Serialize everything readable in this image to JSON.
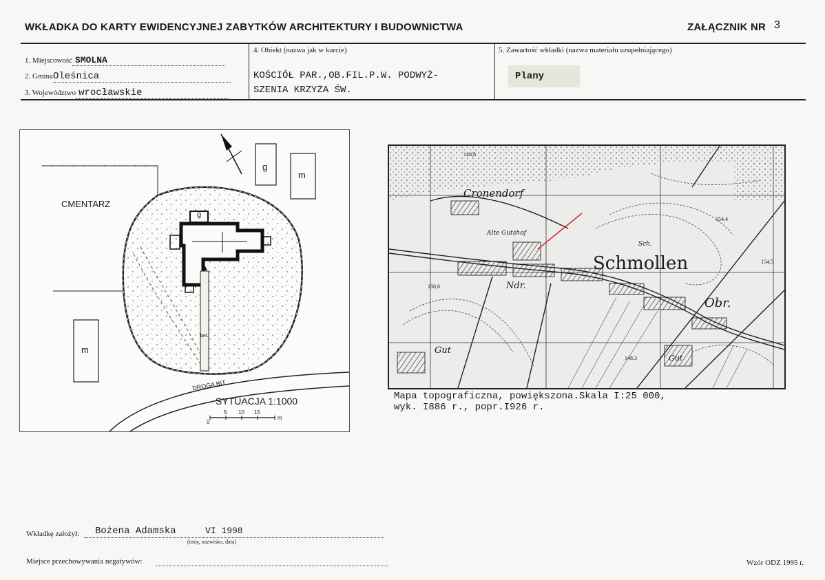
{
  "header": {
    "title": "WKŁADKA DO KARTY EWIDENCYJNEJ ZABYTKÓW ARCHITEKTURY I BUDOWNICTWA",
    "annex": "ZAŁĄCZNIK NR",
    "annex_number": "3"
  },
  "fields": {
    "place_label": "1. Miejscowość",
    "place_value": "SMOLNA",
    "commune_label": "2. Gmina",
    "commune_value": "Oleśnica",
    "voivodeship_label": "3. Województwo",
    "voivodeship_value": "wrocławskie",
    "object_label": "4. Obiekt (nazwa jak w karcie)",
    "object_value_line1": "KOŚCIÓŁ PAR.,OB.FIL.P.W. PODWYŻ-",
    "object_value_line2": "SZENIA KRZYŻA ŚW.",
    "content_label": "5. Zawartość wkładki (nazwa materiału uzupełniającego)",
    "content_value": "Plany"
  },
  "site_plan": {
    "cemetery_label": "CMENTARZ",
    "building_g": "g",
    "building_m": "m",
    "road_label": "DROGA BIT.",
    "path_label": "bet.",
    "scale_title": "SYTUACJA 1:1000",
    "scale_ticks": [
      "0",
      "5",
      "10",
      "15"
    ],
    "scale_unit": "m"
  },
  "map": {
    "town_label": "Schmollen",
    "village_label": "Cronendorf",
    "labels": [
      "Alte Gutshof",
      "Ndr.",
      "Obr.",
      "Gut",
      "Gut",
      "Sch."
    ],
    "elevations": [
      "140,8",
      "138,6",
      "154,4",
      "154,5",
      "148,3"
    ],
    "caption_line1": "Mapa topograficzna, powiększona.Skala I:25 000,",
    "caption_line2": "wyk. I886 r., popr.I926 r."
  },
  "footer": {
    "author_label": "Wkładkę założył:",
    "author_value": "Bożena Adamska",
    "date_value": "VI 1998",
    "author_hint": "(imię, nazwisko, data)",
    "negatives_label": "Miejsce przechowywania negatywów:",
    "form_id": "Wzór ODZ 1995 r."
  }
}
